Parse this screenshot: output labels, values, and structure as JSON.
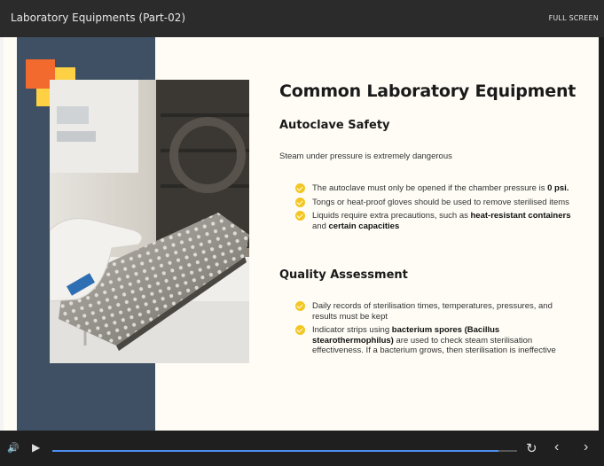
{
  "window": {
    "title": "Laboratory Equipments (Part-02)",
    "fullscreen_label": "FULL SCREEN"
  },
  "slide": {
    "title": "Common Laboratory Equipment",
    "section1": {
      "heading": "Autoclave Safety",
      "intro": "Steam under pressure is extremely dangerous",
      "bullets": [
        {
          "parts": [
            {
              "text": "The autoclave must only be opened if the chamber pressure is ",
              "bold": false
            },
            {
              "text": "0 psi.",
              "bold": true
            }
          ]
        },
        {
          "parts": [
            {
              "text": "Tongs or heat-proof gloves should be used to remove sterilised items",
              "bold": false
            }
          ]
        },
        {
          "parts": [
            {
              "text": "Liquids require extra precautions, such as ",
              "bold": false
            },
            {
              "text": "heat-resistant containers",
              "bold": true
            },
            {
              "text": " and ",
              "bold": false
            },
            {
              "text": "certain capacities",
              "bold": true
            }
          ]
        }
      ]
    },
    "section2": {
      "heading": "Quality Assessment",
      "bullets": [
        {
          "parts": [
            {
              "text": "Daily records of sterilisation times, temperatures, pressures, and results must be kept",
              "bold": false
            }
          ]
        },
        {
          "parts": [
            {
              "text": "Indicator strips using ",
              "bold": false
            },
            {
              "text": "bacterium spores (Bacillus stearothermophilus)",
              "bold": true
            },
            {
              "text": " are used to check steam sterilisation effectiveness. If a bacterium grows, then sterilisation is ineffective",
              "bold": false
            }
          ]
        }
      ]
    },
    "colors": {
      "navy": "#3f5064",
      "orange": "#f26a2e",
      "yellow": "#fdd143",
      "bullet": "#f3c623",
      "progress": "#4d8ff0"
    }
  },
  "player": {
    "progress": 0.96,
    "icons": [
      "volume-icon",
      "play-icon",
      "replay-icon",
      "prev-icon",
      "next-icon"
    ]
  }
}
